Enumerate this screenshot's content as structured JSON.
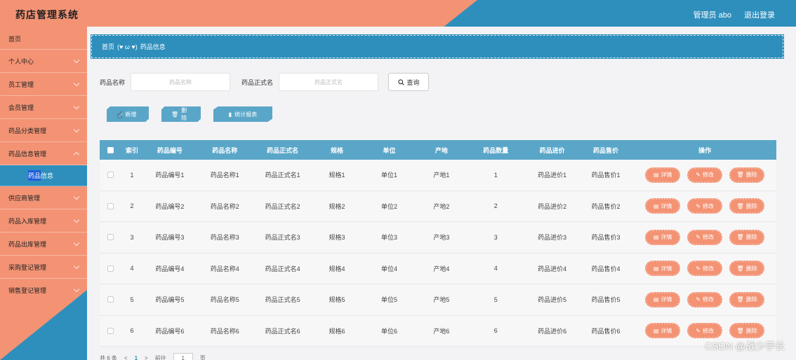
{
  "header": {
    "title": "药店管理系统",
    "user": "管理员 abo",
    "logout": "退出登录"
  },
  "sidebar": {
    "items": [
      {
        "label": "首页"
      },
      {
        "label": "个人中心"
      },
      {
        "label": "员工管理"
      },
      {
        "label": "会员管理"
      },
      {
        "label": "药品分类管理"
      },
      {
        "label": "药品信息管理"
      }
    ],
    "submenu": {
      "highlight": "药品",
      "rest": "信息"
    },
    "items_after": [
      {
        "label": "供应商管理"
      },
      {
        "label": "药品入库管理"
      },
      {
        "label": "药品出库管理"
      },
      {
        "label": "采购登记管理"
      },
      {
        "label": "销售登记管理"
      }
    ]
  },
  "breadcrumb": {
    "home": "首页",
    "sep": "(♥ ω ♥)",
    "current": "药品信息"
  },
  "search": {
    "name_label": "药品名称",
    "name_placeholder": "药品名称",
    "formal_label": "药品正式名",
    "formal_placeholder": "药品正式名",
    "button": "查询"
  },
  "actions": {
    "add": "新增",
    "delete": "删除",
    "stats": "统计报表"
  },
  "table": {
    "headers": [
      "索引",
      "药品编号",
      "药品名称",
      "药品正式名",
      "规格",
      "单位",
      "产地",
      "药品数量",
      "药品进价",
      "药品售价",
      "操作"
    ],
    "rows": [
      [
        "1",
        "药品编号1",
        "药品名称1",
        "药品正式名1",
        "规格1",
        "单位1",
        "产地1",
        "1",
        "药品进价1",
        "药品售价1"
      ],
      [
        "2",
        "药品编号2",
        "药品名称2",
        "药品正式名2",
        "规格2",
        "单位2",
        "产地2",
        "2",
        "药品进价2",
        "药品售价2"
      ],
      [
        "3",
        "药品编号3",
        "药品名称3",
        "药品正式名3",
        "规格3",
        "单位3",
        "产地3",
        "3",
        "药品进价3",
        "药品售价3"
      ],
      [
        "4",
        "药品编号4",
        "药品名称4",
        "药品正式名4",
        "规格4",
        "单位4",
        "产地4",
        "4",
        "药品进价4",
        "药品售价4"
      ],
      [
        "5",
        "药品编号5",
        "药品名称5",
        "药品正式名5",
        "规格5",
        "单位5",
        "产地5",
        "5",
        "药品进价5",
        "药品售价5"
      ],
      [
        "6",
        "药品编号6",
        "药品名称6",
        "药品正式名6",
        "规格6",
        "单位6",
        "产地6",
        "6",
        "药品进价6",
        "药品售价6"
      ]
    ],
    "row_buttons": {
      "detail": "详情",
      "edit": "修改",
      "delete": "删除"
    }
  },
  "pager": {
    "total": "共 6 条",
    "prev": "<",
    "page": "1",
    "next": ">",
    "goto": "前往",
    "goto_value": "1",
    "unit": "页"
  },
  "watermark": "CSDN @战少学长",
  "colors": {
    "accent": "#2e8fbd",
    "salmon": "#f39374",
    "table_header": "#5aa6c8"
  }
}
